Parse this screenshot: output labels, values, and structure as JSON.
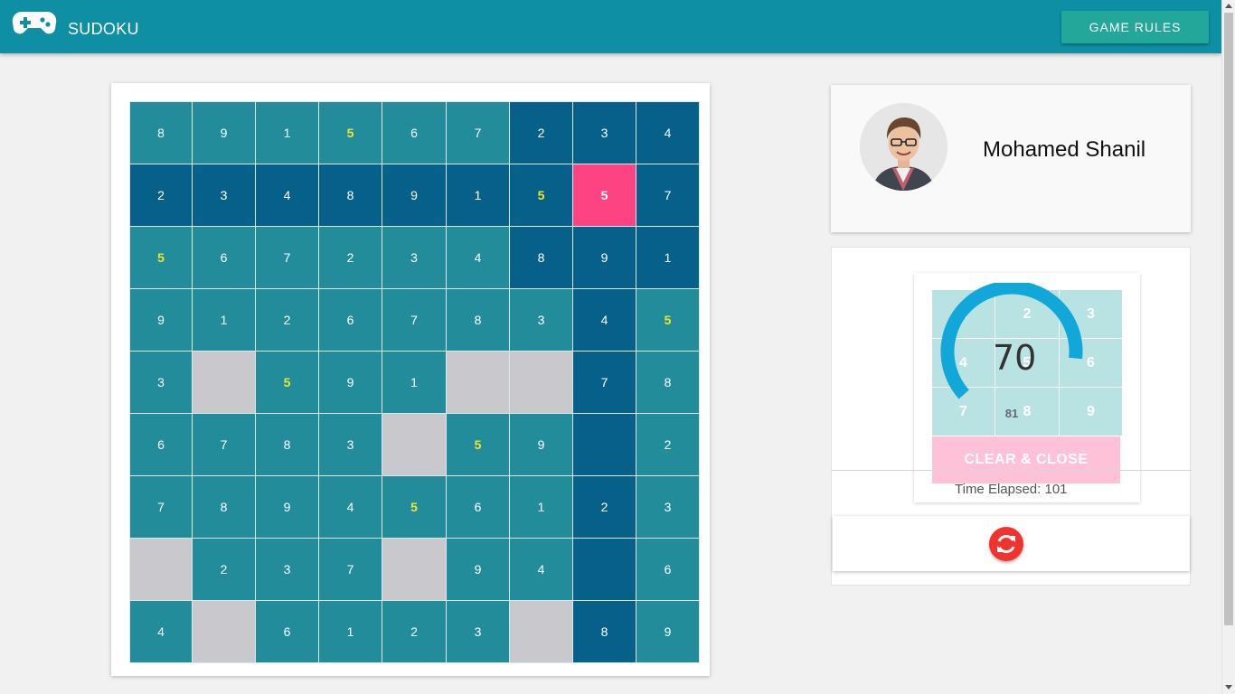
{
  "header": {
    "title": "SUDOKU",
    "rules_label": "GAME RULES",
    "logo_icon": "gamepad-icon"
  },
  "board": {
    "rows": [
      [
        "8",
        "9",
        "1",
        "5",
        "6",
        "7",
        "2",
        "3",
        "4"
      ],
      [
        "2",
        "3",
        "4",
        "8",
        "9",
        "1",
        "5",
        "5",
        "7"
      ],
      [
        "5",
        "6",
        "7",
        "2",
        "3",
        "4",
        "8",
        "9",
        "1"
      ],
      [
        "9",
        "1",
        "2",
        "6",
        "7",
        "8",
        "3",
        "4",
        "5"
      ],
      [
        "3",
        "",
        "5",
        "9",
        "1",
        "",
        "",
        "7",
        "8"
      ],
      [
        "6",
        "7",
        "8",
        "3",
        "",
        "5",
        "9",
        "",
        "2"
      ],
      [
        "7",
        "8",
        "9",
        "4",
        "5",
        "6",
        "1",
        "2",
        "3"
      ],
      [
        "",
        "2",
        "3",
        "7",
        "",
        "9",
        "4",
        "",
        "6"
      ],
      [
        "4",
        "",
        "6",
        "1",
        "2",
        "3",
        "",
        "8",
        "9"
      ]
    ],
    "highlighted_digit": "5",
    "conflict_cell": [
      1,
      7
    ]
  },
  "profile": {
    "name": "Mohamed Shanil",
    "avatar_icon": "user-avatar"
  },
  "picker": {
    "numbers": [
      "1",
      "2",
      "3",
      "4",
      "5",
      "6",
      "7",
      "8",
      "9"
    ],
    "clear_label": "CLEAR & CLOSE",
    "gauge": {
      "value": "70",
      "max": "81",
      "fraction": 0.864
    }
  },
  "timer": {
    "text": "Time Elapsed: 101"
  },
  "refresh": {
    "icon": "refresh-icon"
  },
  "colors": {
    "header": "#0f8fa3",
    "rules_button": "#22a79a",
    "cell_teal": "#228c9b",
    "cell_dark": "#066089",
    "cell_empty": "#c9c8cc",
    "cell_conflict": "#fd4382",
    "highlight_digit": "#f0e52d",
    "gauge": "#11a7d8",
    "clear_button": "#ffc1d7",
    "refresh_button": "#f2322c"
  }
}
